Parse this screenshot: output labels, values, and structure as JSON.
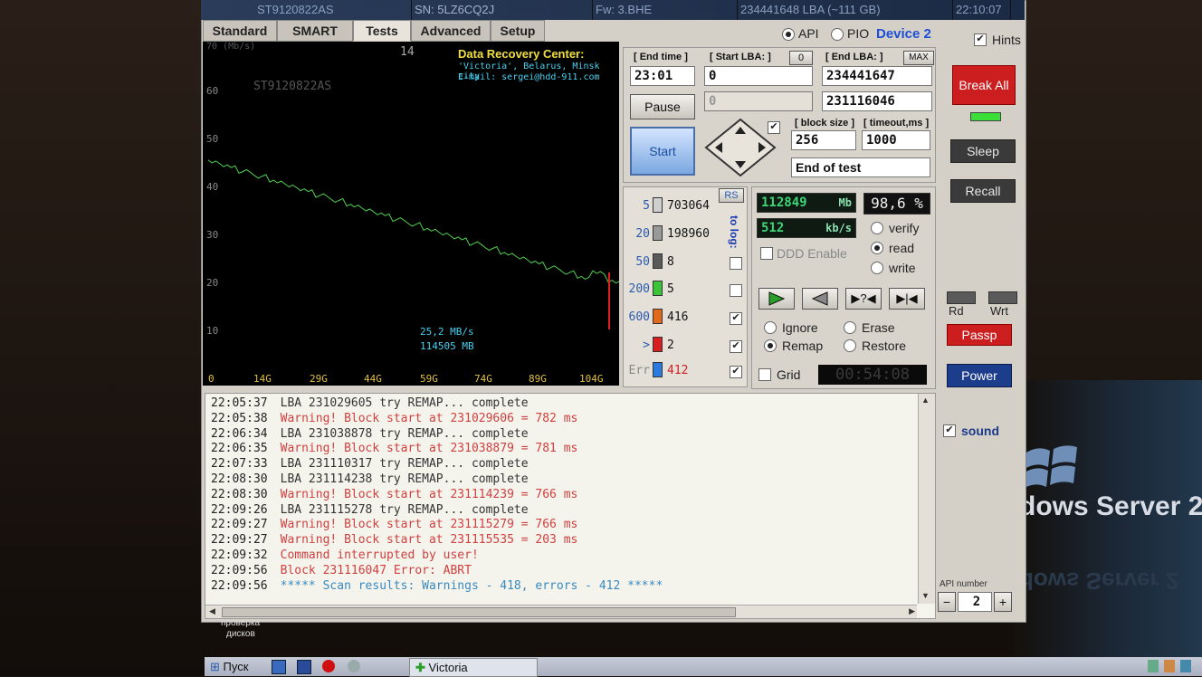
{
  "titlebar": {
    "model": "ST9120822AS",
    "serial": "SN: 5LZ6CQ2J",
    "firmware": "Fw: 3.BHE",
    "lba_size": "234441648 LBA (~111 GB)",
    "clock": "22:10:07"
  },
  "tabs": [
    "Standard",
    "SMART",
    "Tests",
    "Advanced",
    "Setup"
  ],
  "active_tab": "Tests",
  "mode": {
    "api": "API",
    "pio": "PIO",
    "device": "Device 2",
    "hints": "Hints"
  },
  "graph": {
    "unit": "70 (Mb/s)",
    "top_value": "14",
    "drive_label": "ST9120822AS",
    "credit_line1": "Data Recovery Center:",
    "credit_line2": "'Victoria', Belarus, Minsk city",
    "credit_line3": "E-mail: sergei@hdd-911.com",
    "y_ticks": [
      "60",
      "50",
      "40",
      "30",
      "20",
      "10"
    ],
    "x_ticks": [
      "0",
      "14G",
      "29G",
      "44G",
      "59G",
      "74G",
      "89G",
      "104G"
    ],
    "speed": "25,2 MB/s",
    "position_mb": "114505 MB",
    "line_color": "#4fd14f"
  },
  "chart_data": {
    "type": "line",
    "series": [
      {
        "values": [
          45,
          44,
          43,
          42,
          41,
          40,
          39,
          38,
          37,
          36,
          35,
          34,
          33,
          32,
          31,
          30,
          29,
          28,
          27,
          26,
          25,
          24,
          23,
          22,
          21,
          22,
          20
        ]
      }
    ],
    "ylim": [
      0,
      70
    ]
  },
  "controls": {
    "end_time_label": "[ End time ]",
    "end_time": "23:01",
    "start_lba_label": "[ Start LBA: ]",
    "start_lba_zero_btn": "0",
    "start_lba": "0",
    "start_lba_current": "0",
    "end_lba_label": "[ End LBA: ]",
    "end_lba_max_btn": "MAX",
    "end_lba": "234441647",
    "end_lba_current": "231116046",
    "pause": "Pause",
    "start": "Start",
    "block_size_label": "[ block size ]",
    "block_size": "256",
    "timeout_label": "[ timeout,ms ]",
    "timeout": "1000",
    "end_action": "End of test"
  },
  "blocks": {
    "rs_button": "RS",
    "to_log": "to log:",
    "rows": [
      {
        "threshold": "5",
        "count": "703064",
        "color": "#cfcfcf",
        "checked": false
      },
      {
        "threshold": "20",
        "count": "198960",
        "color": "#9a9a9a",
        "checked": false
      },
      {
        "threshold": "50",
        "count": "8",
        "color": "#5a5a5a",
        "checked": false
      },
      {
        "threshold": "200",
        "count": "5",
        "color": "#3ac43a",
        "checked": false
      },
      {
        "threshold": "600",
        "count": "416",
        "color": "#e06a1a",
        "checked": true
      },
      {
        "threshold": ">",
        "count": "2",
        "color": "#d81e1e",
        "checked": true
      },
      {
        "threshold": "Err",
        "count": "412",
        "color": "#2a7ae0",
        "checked": true
      }
    ]
  },
  "stats": {
    "scanned": "112849",
    "scanned_unit": "Mb",
    "percent": "98,6 %",
    "speed": "512",
    "speed_unit": "kb/s",
    "ddd": "DDD Enable",
    "verify": "verify",
    "read": "read",
    "write": "write",
    "ignore": "Ignore",
    "erase": "Erase",
    "remap": "Remap",
    "restore": "Restore",
    "grid": "Grid",
    "timer": "00:54:08"
  },
  "right_panel": {
    "break_all": "Break All",
    "sleep": "Sleep",
    "recall": "Recall",
    "rd": "Rd",
    "wrt": "Wrt",
    "passp": "Passp",
    "power": "Power",
    "sound": "sound",
    "api_number_label": "API number",
    "api_minus": "−",
    "api_number": "2",
    "api_plus": "+"
  },
  "log": [
    {
      "time": "22:05:37",
      "msg": "LBA 231029605 try REMAP... complete",
      "kind": "ok"
    },
    {
      "time": "22:05:38",
      "msg": "Warning! Block start at 231029606 = 782 ms",
      "kind": "warn"
    },
    {
      "time": "22:06:34",
      "msg": "LBA 231038878 try REMAP... complete",
      "kind": "ok"
    },
    {
      "time": "22:06:35",
      "msg": "Warning! Block start at 231038879 = 781 ms",
      "kind": "warn"
    },
    {
      "time": "22:07:33",
      "msg": "LBA 231110317 try REMAP... complete",
      "kind": "ok"
    },
    {
      "time": "22:08:30",
      "msg": "LBA 231114238 try REMAP... complete",
      "kind": "ok"
    },
    {
      "time": "22:08:30",
      "msg": "Warning! Block start at 231114239 = 766 ms",
      "kind": "warn"
    },
    {
      "time": "22:09:26",
      "msg": "LBA 231115278 try REMAP... complete",
      "kind": "ok"
    },
    {
      "time": "22:09:27",
      "msg": "Warning! Block start at 231115279 = 766 ms",
      "kind": "warn"
    },
    {
      "time": "22:09:27",
      "msg": "Warning! Block start at 231115535 = 203 ms",
      "kind": "warn"
    },
    {
      "time": "22:09:32",
      "msg": "Command interrupted by user!",
      "kind": "warn"
    },
    {
      "time": "22:09:56",
      "msg": "Block 231116047 Error: ABRT",
      "kind": "warn"
    },
    {
      "time": "22:09:56",
      "msg": "***** Scan results: Warnings - 418, errors - 412 *****",
      "kind": "info"
    }
  ],
  "desktop": {
    "brand": "dows Server 2",
    "brand_reflection": "dows Server 2",
    "desktop_icon_label1": "проверка",
    "desktop_icon_label2": "дисков"
  },
  "taskbar": {
    "start": "Пуск",
    "task": "Victoria"
  }
}
